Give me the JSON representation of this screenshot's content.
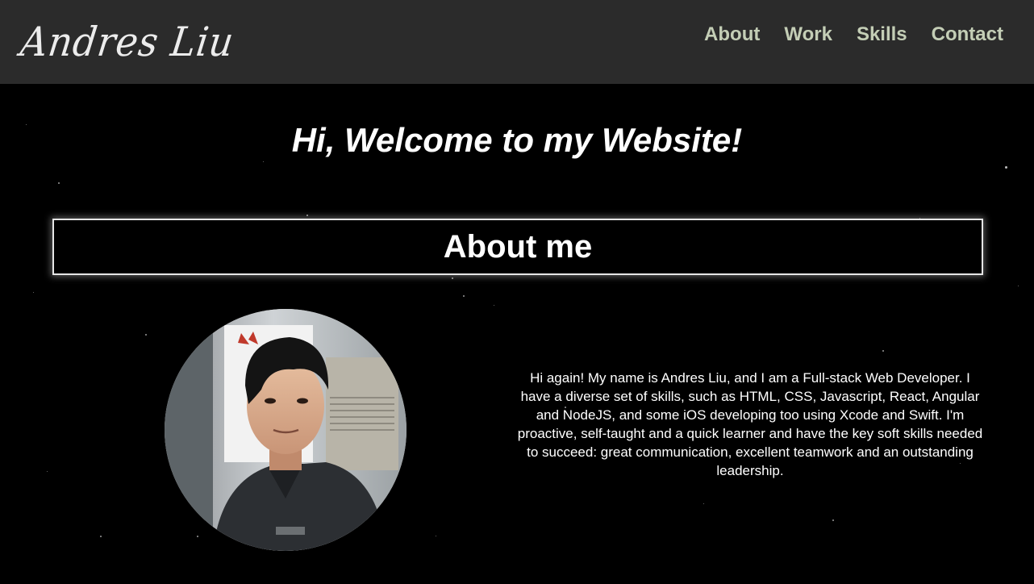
{
  "header": {
    "brand": "Andres Liu",
    "nav": [
      "About",
      "Work",
      "Skills",
      "Contact"
    ]
  },
  "hero": {
    "welcome": "Hi, Welcome to my Website!"
  },
  "about": {
    "title": "About me",
    "bio": "Hi again! My name is Andres Liu, and I am a Full-stack Web Developer. I have a diverse set of skills, such as HTML, CSS, Javascript, React, Angular and NodeJS, and some iOS developing too using Xcode and Swift. I'm proactive, self-taught and a quick learner and have the key soft skills needed to succeed: great communication, excellent teamwork and an outstanding leadership.",
    "photo_alt": "Andres Liu"
  },
  "colors": {
    "header_bg": "#2b2b2b",
    "nav_link": "#c4ceb6",
    "background": "#000000",
    "text": "#ffffff"
  },
  "icons": [
    "starfield-background"
  ]
}
